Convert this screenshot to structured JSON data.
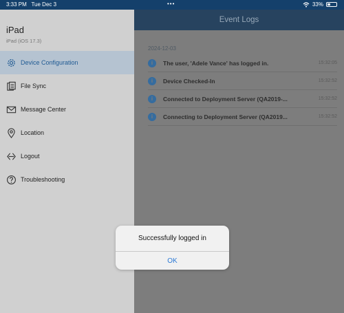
{
  "status_bar": {
    "time": "3:33 PM",
    "date": "Tue Dec 3",
    "dots": "•••",
    "battery": "33%",
    "icons": [
      "wifi-icon",
      "battery-icon"
    ]
  },
  "device": {
    "name": "iPad",
    "os": "iPad (iOS 17.3)"
  },
  "sidebar": {
    "items": [
      {
        "label": "Device Configuration",
        "icon": "gear-icon",
        "active": true
      },
      {
        "label": "File Sync",
        "icon": "file-sync-icon"
      },
      {
        "label": "Message Center",
        "icon": "envelope-icon"
      },
      {
        "label": "Location",
        "icon": "location-pin-icon"
      },
      {
        "label": "Logout",
        "icon": "logout-icon"
      },
      {
        "label": "Troubleshooting",
        "icon": "question-icon"
      }
    ]
  },
  "main": {
    "title": "Event Logs",
    "date": "2024-12-03",
    "logs": [
      {
        "message": "The user, 'Adele Vance' has logged in.",
        "time": "15:32:05"
      },
      {
        "message": "Device Checked-In",
        "time": "15:32:52"
      },
      {
        "message": "Connected to Deployment Server (QA2019-...",
        "time": "15:32:52"
      },
      {
        "message": "Connecting to Deployment Server (QA2019...",
        "time": "15:32:52"
      }
    ]
  },
  "alert": {
    "title": "Successfully logged in",
    "ok_label": "OK"
  },
  "colors": {
    "accent": "#1f5a93",
    "header": "#27435f",
    "status_bar": "#14406b",
    "alert_button": "#2b79d6"
  }
}
